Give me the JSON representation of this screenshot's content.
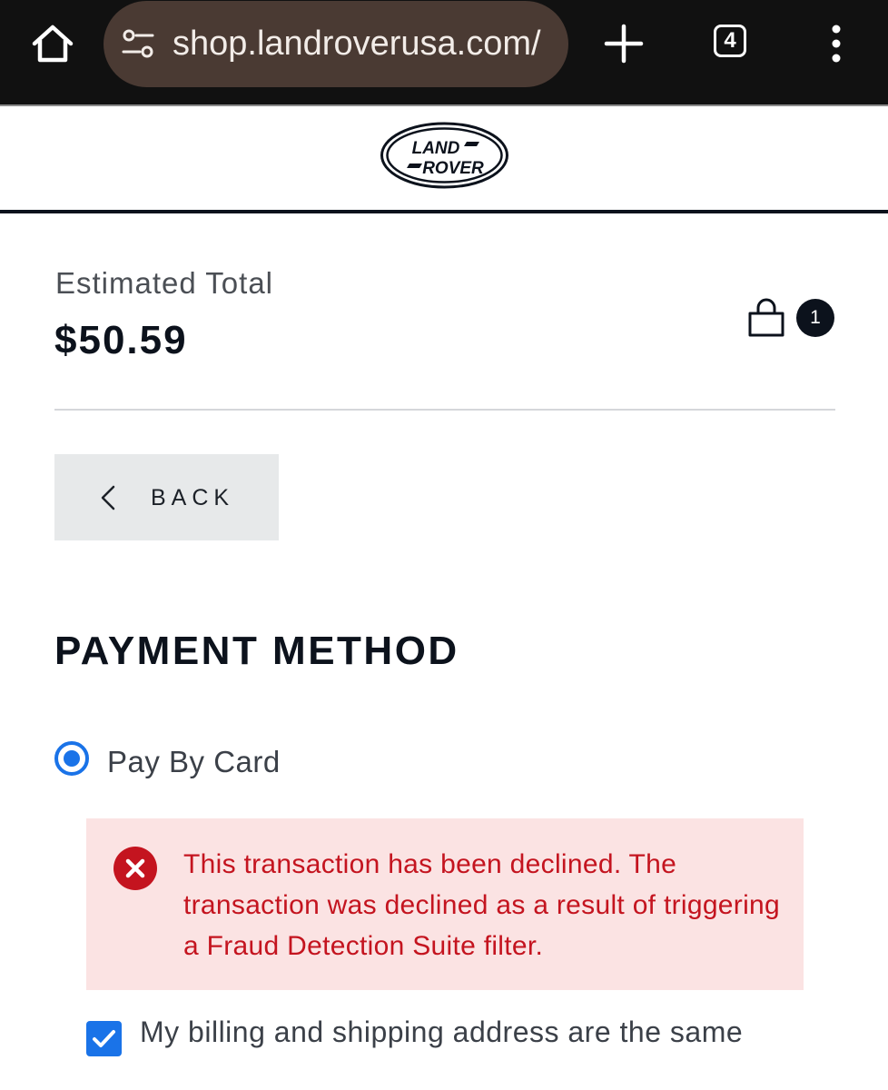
{
  "browser": {
    "url": "shop.landroverusa.com/",
    "tab_count": "4",
    "icons": {
      "home": "home-icon",
      "site_settings": "tune-icon",
      "new_tab": "plus-icon",
      "menu": "more-vert-icon"
    }
  },
  "header": {
    "logo_line1": "LAND",
    "logo_line2": "ROVER"
  },
  "summary": {
    "estimated_total_label": "Estimated Total",
    "estimated_total_amount": "$50.59",
    "cart_count": "1",
    "cart_icon": "shopping-bag-icon"
  },
  "back_button": {
    "label": "BACK",
    "icon": "chevron-left-icon"
  },
  "payment": {
    "title": "PAYMENT METHOD",
    "option_label": "Pay By Card",
    "option_selected": true,
    "error_message": "This transaction has been declined. The transaction was declined as a result of triggering a Fraud Detection Suite filter.",
    "error_icon": "error-circle-icon",
    "billing_same_label": "My billing and shipping address are the same",
    "billing_same_checked": true
  },
  "colors": {
    "chrome_bg": "#111111",
    "urlbar_bg": "#4a3a33",
    "text_dark": "#0c121c",
    "accent_blue": "#1a73e8",
    "error_red": "#c4141f",
    "error_bg": "#fbe3e3",
    "back_bg": "#e7e9ea"
  }
}
